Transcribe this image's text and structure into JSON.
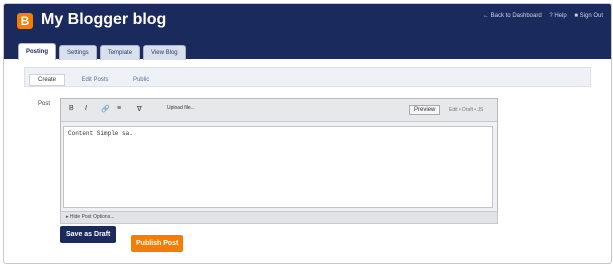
{
  "header": {
    "logo_letter": "B",
    "blog_title": "My Blogger blog",
    "links": [
      "← Back to Dashboard",
      "? Help",
      "■ Sign Out"
    ]
  },
  "tabs": [
    {
      "label": "Posting",
      "active": true
    },
    {
      "label": "Settings",
      "active": false
    },
    {
      "label": "Template",
      "active": false
    },
    {
      "label": "View Blog",
      "active": false
    }
  ],
  "subtabs": [
    {
      "label": "Create",
      "active": true
    },
    {
      "label": "Edit Posts",
      "active": false
    },
    {
      "label": "Public",
      "active": false
    }
  ],
  "editor": {
    "post_label": "Post",
    "toolbar": [
      "B",
      "I",
      "🔗",
      "≡",
      "∇"
    ],
    "upload_label": "Upload file...",
    "preview_label": "Preview",
    "mode_links": "Edit • Draft • JS",
    "content": "Content  Simple sa.",
    "post_options": "▸ Hide Post Options..."
  },
  "buttons": {
    "save_draft": "Save as Draft",
    "publish": "Publish Post"
  },
  "colors": {
    "header_bg": "#1a2a5c",
    "brand_orange": "#f57d00"
  }
}
